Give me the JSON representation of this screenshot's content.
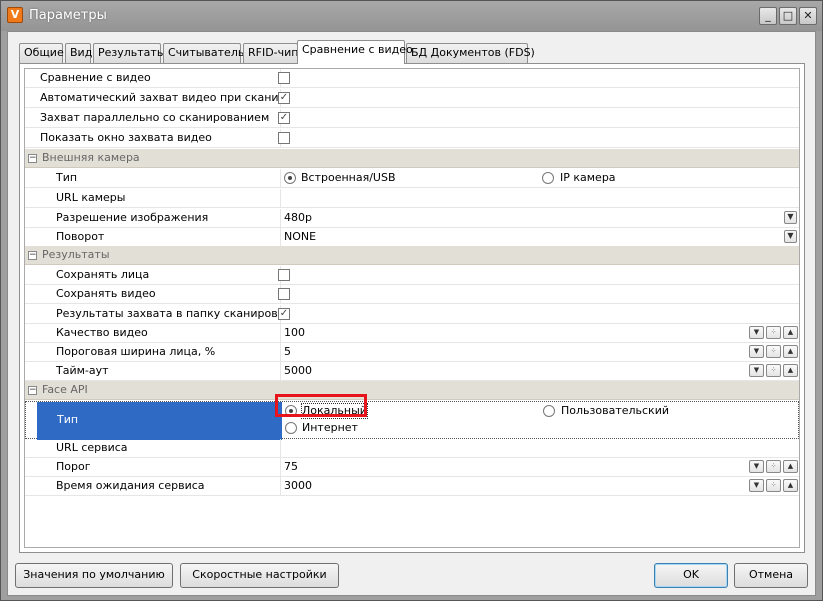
{
  "window": {
    "title": "Параметры",
    "app_icon_glyph": "V",
    "controls": [
      "_",
      "□",
      "✕"
    ]
  },
  "tabs": [
    "Общие",
    "Вид",
    "Результаты",
    "Считыватель",
    "RFID-чип",
    "Сравнение с видео",
    "БД Документов (FDS)"
  ],
  "active_tab": "Сравнение с видео",
  "top_rows": [
    {
      "label": "Сравнение с видео",
      "checked": false
    },
    {
      "label": "Автоматический захват видео при сканиро…",
      "checked": true
    },
    {
      "label": "Захват параллельно со сканированием",
      "checked": true
    },
    {
      "label": "Показать окно захвата видео",
      "checked": false
    }
  ],
  "external_camera": {
    "title": "Внешняя камера",
    "type_label": "Тип",
    "type_options": [
      "Встроенная/USB",
      "IP камера"
    ],
    "type_selected": "Встроенная/USB",
    "url_label": "URL камеры",
    "url_value": "",
    "resolution_label": "Разрешение изображения",
    "resolution_value": "480p",
    "rotation_label": "Поворот",
    "rotation_value": "NONE"
  },
  "results": {
    "title": "Результаты",
    "save_faces_label": "Сохранять лица",
    "save_faces": false,
    "save_video_label": "Сохранять видео",
    "save_video": false,
    "capture_results_label": "Результаты захвата в папку сканирова…",
    "capture_results": true,
    "video_quality_label": "Качество видео",
    "video_quality_value": "100",
    "face_width_label": "Пороговая ширина лица, %",
    "face_width_value": "5",
    "timeout_label": "Тайм-аут",
    "timeout_value": "5000"
  },
  "face_api": {
    "title": "Face API",
    "type_label": "Тип",
    "type_options": [
      "Локальный",
      "Пользовательский",
      "Интернет"
    ],
    "type_selected": "Локальный",
    "url_label": "URL сервиса",
    "url_value": "",
    "threshold_label": "Порог",
    "threshold_value": "75",
    "timeout_label": "Время ожидания сервиса",
    "timeout_value": "3000"
  },
  "buttons": {
    "defaults": "Значения по умолчанию",
    "quick": "Скоростные настройки",
    "ok": "OK",
    "cancel": "Отмена"
  },
  "colors": {
    "selection": "#2f6ac5",
    "highlight": "#e8141c",
    "category_bg": "#e2dfd6"
  }
}
